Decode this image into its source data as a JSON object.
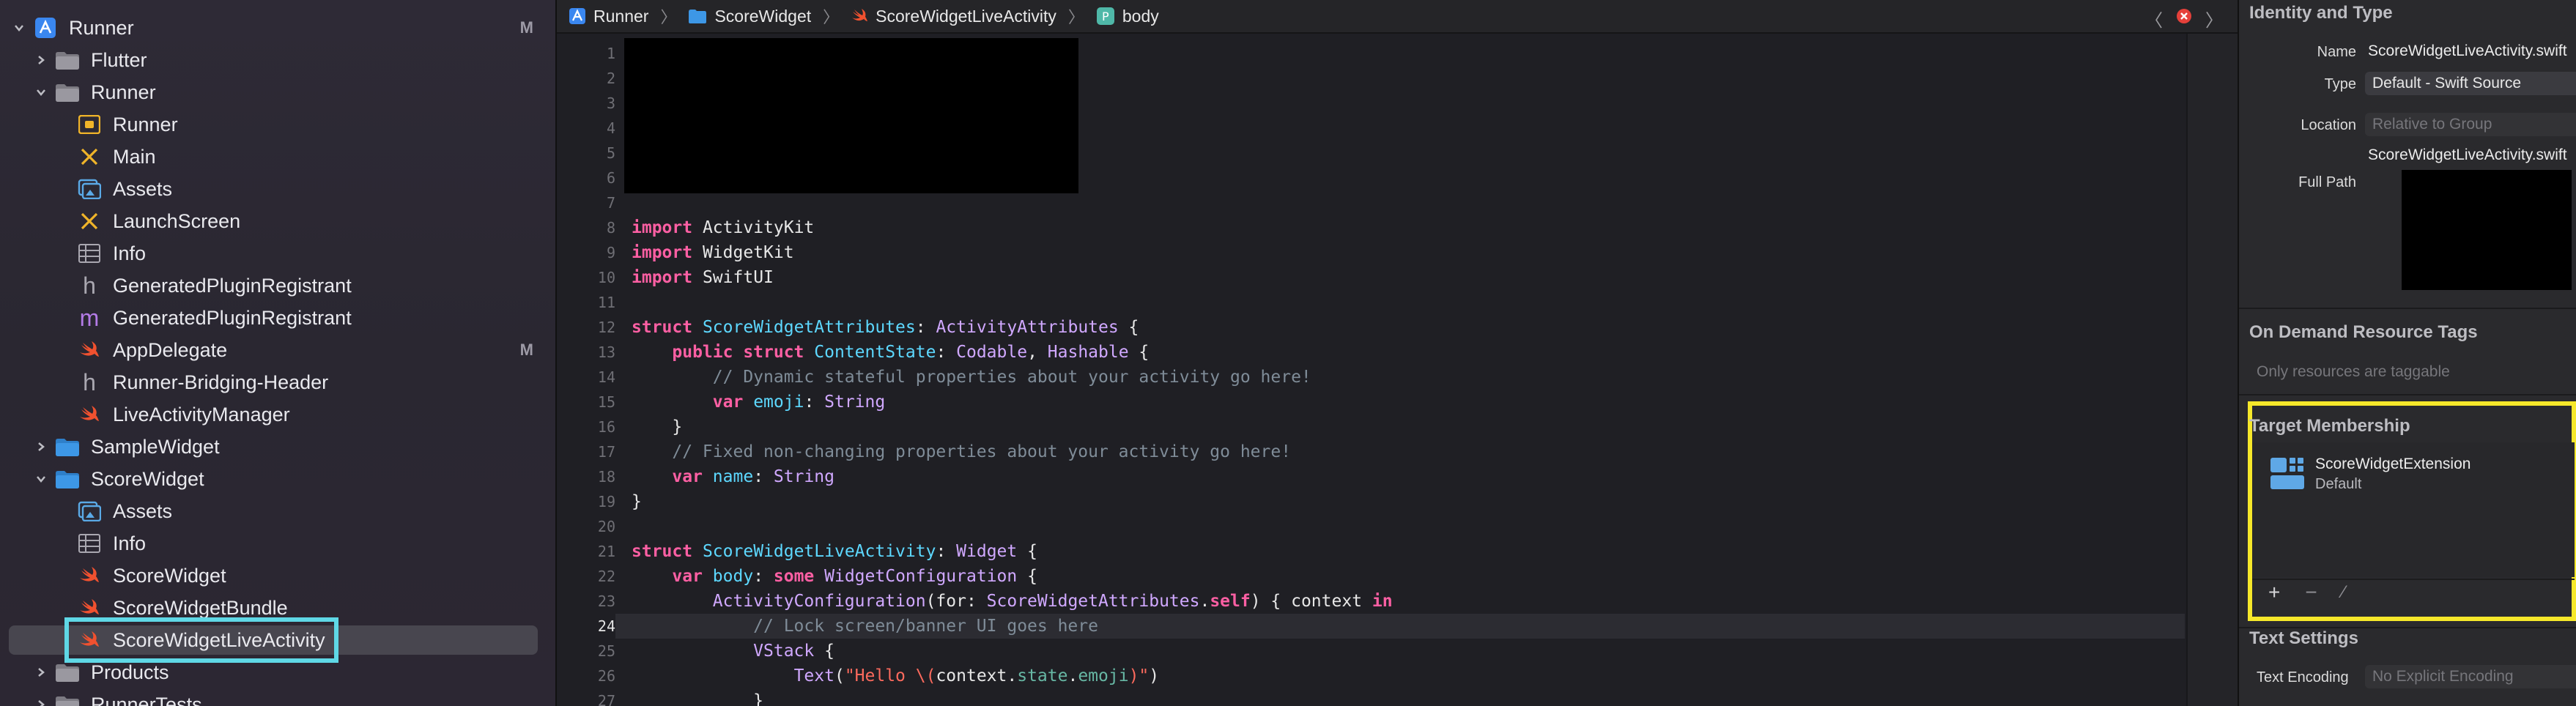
{
  "navigator": {
    "items": [
      {
        "label": "Runner",
        "icon": "project-icon",
        "disclosure": "open",
        "scm": "M"
      },
      {
        "label": "Flutter",
        "icon": "folder-icon",
        "disclosure": "closed",
        "scm": ""
      },
      {
        "label": "Runner",
        "icon": "folder-icon",
        "disclosure": "open",
        "scm": ""
      },
      {
        "label": "Runner",
        "icon": "asset-catalog-icon",
        "disclosure": "",
        "scm": ""
      },
      {
        "label": "Main",
        "icon": "storyboard-icon",
        "disclosure": "",
        "scm": ""
      },
      {
        "label": "Assets",
        "icon": "assets-icon",
        "disclosure": "",
        "scm": ""
      },
      {
        "label": "LaunchScreen",
        "icon": "storyboard-icon",
        "disclosure": "",
        "scm": ""
      },
      {
        "label": "Info",
        "icon": "plist-icon",
        "disclosure": "",
        "scm": ""
      },
      {
        "label": "GeneratedPluginRegistrant",
        "icon": "header-icon",
        "disclosure": "",
        "scm": ""
      },
      {
        "label": "GeneratedPluginRegistrant",
        "icon": "objc-m-icon",
        "disclosure": "",
        "scm": ""
      },
      {
        "label": "AppDelegate",
        "icon": "swift-icon",
        "disclosure": "",
        "scm": "M"
      },
      {
        "label": "Runner-Bridging-Header",
        "icon": "header-icon",
        "disclosure": "",
        "scm": ""
      },
      {
        "label": "LiveActivityManager",
        "icon": "swift-icon",
        "disclosure": "",
        "scm": ""
      },
      {
        "label": "SampleWidget",
        "icon": "folder-icon",
        "disclosure": "closed",
        "scm": ""
      },
      {
        "label": "ScoreWidget",
        "icon": "folder-icon",
        "disclosure": "open",
        "scm": ""
      },
      {
        "label": "Assets",
        "icon": "assets-icon",
        "disclosure": "",
        "scm": ""
      },
      {
        "label": "Info",
        "icon": "plist-icon",
        "disclosure": "",
        "scm": ""
      },
      {
        "label": "ScoreWidget",
        "icon": "swift-icon",
        "disclosure": "",
        "scm": ""
      },
      {
        "label": "ScoreWidgetBundle",
        "icon": "swift-icon",
        "disclosure": "",
        "scm": ""
      },
      {
        "label": "ScoreWidgetLiveActivity",
        "icon": "swift-icon",
        "disclosure": "",
        "scm": ""
      },
      {
        "label": "Products",
        "icon": "folder-icon",
        "disclosure": "closed",
        "scm": ""
      },
      {
        "label": "RunnerTests",
        "icon": "folder-icon",
        "disclosure": "closed",
        "scm": ""
      }
    ]
  },
  "jumpbar": {
    "crumbs": [
      "Runner",
      "ScoreWidget",
      "ScoreWidgetLiveActivity",
      "body"
    ]
  },
  "editor": {
    "line_numbers": [
      "1",
      "2",
      "3",
      "4",
      "5",
      "6",
      "7",
      "8",
      "9",
      "10",
      "11",
      "12",
      "13",
      "14",
      "15",
      "16",
      "17",
      "18",
      "19",
      "20",
      "21",
      "22",
      "23",
      "24",
      "25",
      "26",
      "27"
    ],
    "current_line": "24"
  },
  "inspector": {
    "identity_title": "Identity and Type",
    "name_label": "Name",
    "name_value": "ScoreWidgetLiveActivity.swift",
    "type_label": "Type",
    "type_value": "Default - Swift Source",
    "location_label": "Location",
    "location_value": "Relative to Group",
    "location_file": "ScoreWidgetLiveActivity.swift",
    "fullpath_label": "Full Path",
    "ondemand_title": "On Demand Resource Tags",
    "ondemand_placeholder": "Only resources are taggable",
    "target_title": "Target Membership",
    "target_name": "ScoreWidgetExtension",
    "target_sub": "Default",
    "text_settings_title": "Text Settings",
    "text_encoding_label": "Text Encoding",
    "text_encoding_value": "No Explicit Encoding",
    "highlight_color": "#f6e82a",
    "selection_color": "#5fd8e6"
  }
}
